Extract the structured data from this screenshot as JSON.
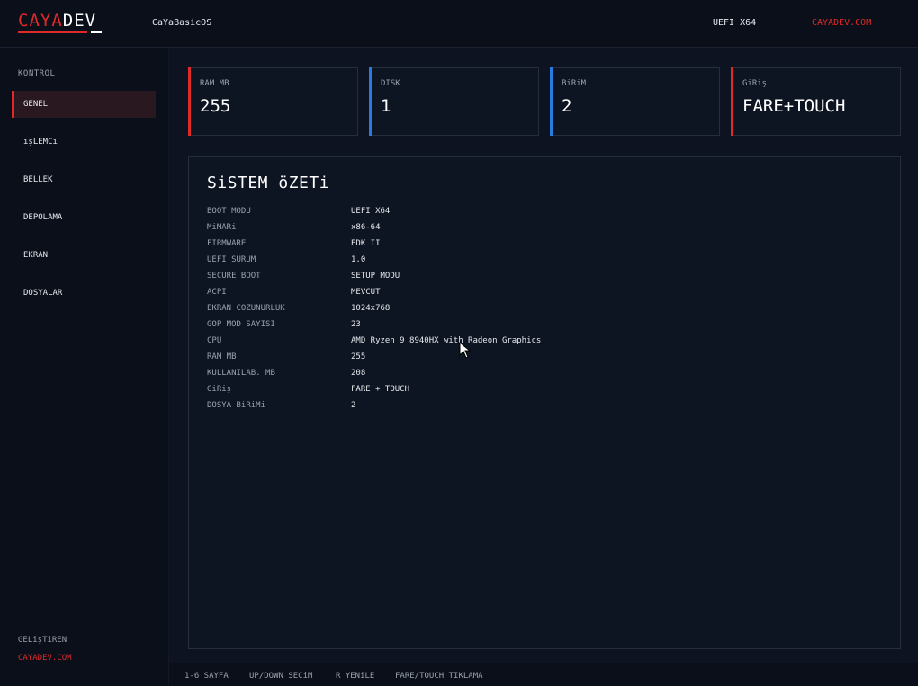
{
  "header": {
    "logo_part1": "CAYA",
    "logo_part2": "DEV",
    "app_name": "CaYaBasicOS",
    "boot_mode": "UEFI X64",
    "site": "CAYADEV.COM"
  },
  "sidebar": {
    "heading": "KONTROL",
    "items": [
      {
        "label": "GENEL",
        "active": true
      },
      {
        "label": "işLEMCi",
        "active": false
      },
      {
        "label": "BELLEK",
        "active": false
      },
      {
        "label": "DEPOLAMA",
        "active": false
      },
      {
        "label": "EKRAN",
        "active": false
      },
      {
        "label": "DOSYALAR",
        "active": false
      }
    ],
    "developer_label": "GELişTiREN",
    "developer_site": "CAYADEV.COM"
  },
  "stats": [
    {
      "label": "RAM MB",
      "value": "255",
      "color": "#e02a2a"
    },
    {
      "label": "DISK",
      "value": "1",
      "color": "#2a7be0"
    },
    {
      "label": "BiRiM",
      "value": "2",
      "color": "#2a7be0"
    },
    {
      "label": "GiRiş",
      "value": "FARE+TOUCH",
      "color": "#e02a2a"
    }
  ],
  "summary": {
    "title": "SiSTEM öZETi",
    "rows": [
      {
        "key": "BOOT MODU",
        "value": "UEFI X64"
      },
      {
        "key": "MiMARi",
        "value": "x86-64"
      },
      {
        "key": "FIRMWARE",
        "value": "EDK II"
      },
      {
        "key": "UEFI SURUM",
        "value": "1.0"
      },
      {
        "key": "SECURE BOOT",
        "value": "SETUP MODU"
      },
      {
        "key": "ACPI",
        "value": "MEVCUT"
      },
      {
        "key": "EKRAN COZUNURLUK",
        "value": "1024x768"
      },
      {
        "key": "GOP MOD SAYISI",
        "value": "23"
      },
      {
        "key": "CPU",
        "value": "AMD Ryzen 9 8940HX with Radeon Graphics"
      },
      {
        "key": "RAM MB",
        "value": "255"
      },
      {
        "key": "KULLANILAB. MB",
        "value": "208"
      },
      {
        "key": "GiRiş",
        "value": "FARE + TOUCH"
      },
      {
        "key": "DOSYA BiRiMi",
        "value": "2"
      }
    ]
  },
  "footer": {
    "items": [
      "1-6 SAYFA",
      "UP/DOWN SECiM",
      "R YENiLE",
      "FARE/TOUCH TIKLAMA"
    ]
  },
  "cursor_icon": "mouse-pointer-icon"
}
